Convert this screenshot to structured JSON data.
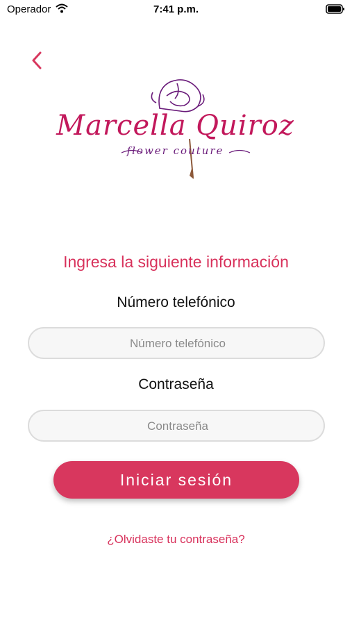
{
  "status_bar": {
    "carrier": "Operador",
    "time": "7:41 p.m."
  },
  "logo": {
    "name": "Marcella Quiroz",
    "tagline": "flower couture"
  },
  "form": {
    "heading": "Ingresa la siguiente información",
    "phone_label": "Número telefónico",
    "phone_placeholder": "Número telefónico",
    "password_label": "Contraseña",
    "password_placeholder": "Contraseña",
    "submit_label": "Iniciar sesión",
    "forgot_link": "¿Olvidaste tu contraseña?"
  },
  "colors": {
    "accent": "#d8375e",
    "logo_primary": "#c2185b",
    "logo_secondary": "#6a1b7a"
  },
  "icons": {
    "back": "chevron-left-icon",
    "wifi": "wifi-icon",
    "battery": "battery-icon"
  }
}
